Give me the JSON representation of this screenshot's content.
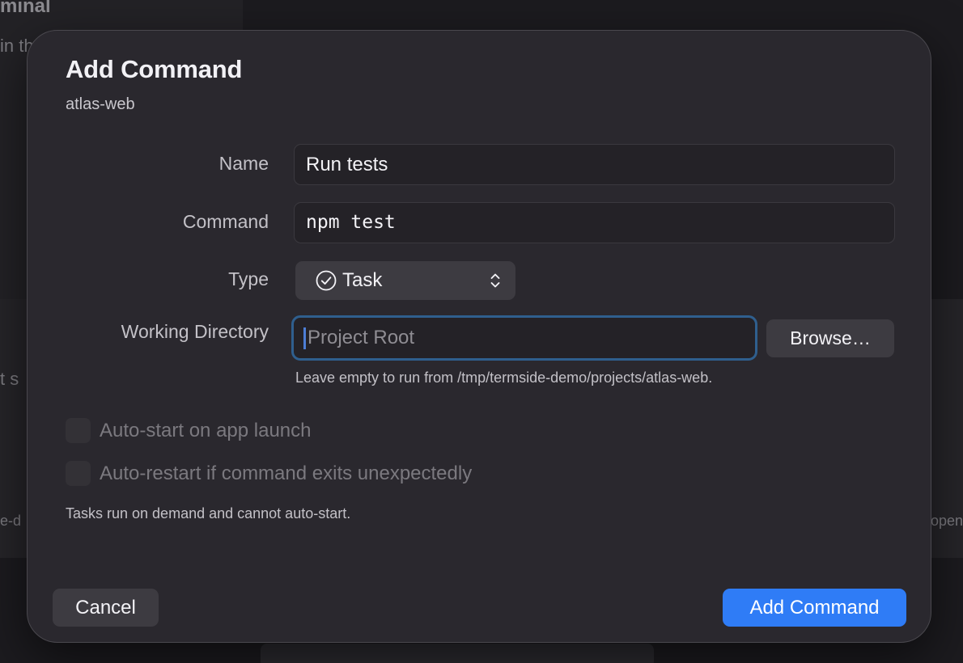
{
  "background": {
    "title_fragment": "minal",
    "text_fragment_1": "in the",
    "text_fragment_2": "t s",
    "text_fragment_3": "e-d",
    "text_fragment_4": "open"
  },
  "dialog": {
    "title": "Add Command",
    "subtitle": "atlas-web",
    "fields": {
      "name_label": "Name",
      "name_value": "Run tests",
      "command_label": "Command",
      "command_value": "npm test",
      "type_label": "Type",
      "type_value": "Task",
      "type_icon": "checkmark-circle-icon",
      "working_dir_label": "Working Directory",
      "working_dir_placeholder": "Project Root",
      "working_dir_value": "",
      "browse_label": "Browse…",
      "working_dir_hint": "Leave empty to run from /tmp/termside-demo/projects/atlas-web."
    },
    "options": {
      "auto_start_label": "Auto-start on app launch",
      "auto_start_checked": false,
      "auto_restart_label": "Auto-restart if command exits unexpectedly",
      "auto_restart_checked": false,
      "note": "Tasks run on demand and cannot auto-start."
    },
    "buttons": {
      "cancel_label": "Cancel",
      "submit_label": "Add Command"
    },
    "colors": {
      "accent": "#2f7cf6",
      "focus_ring": "#2f5f8e",
      "sheet_bg": "#2a282e"
    }
  }
}
